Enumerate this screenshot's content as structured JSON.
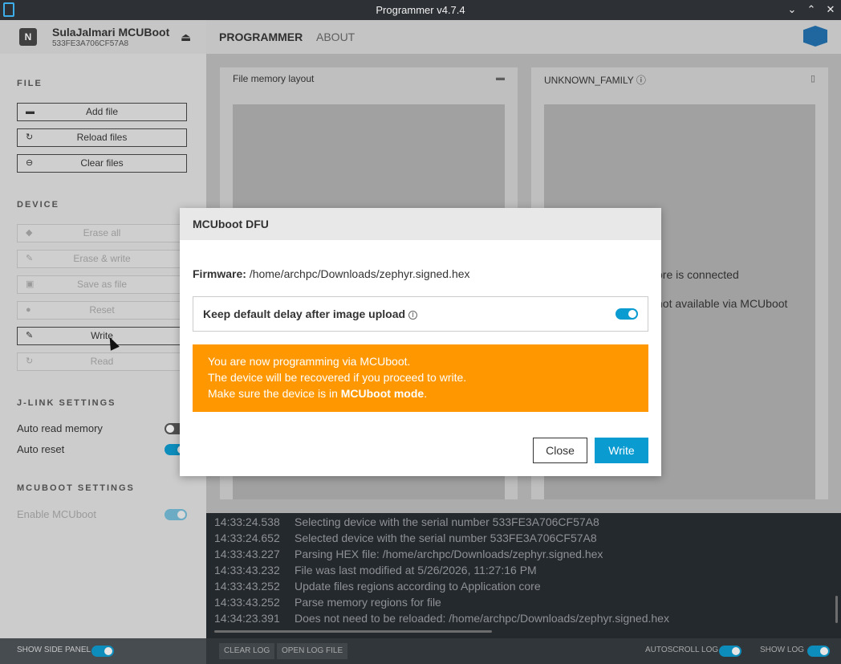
{
  "window": {
    "title": "Programmer v4.7.4",
    "controls": [
      "⌄",
      "⌃",
      "✕"
    ]
  },
  "header": {
    "device_name": "SulaJalmari MCUBoot",
    "device_serial": "533FE3A706CF57A8",
    "chip_letter": "N",
    "tabs": [
      "PROGRAMMER",
      "ABOUT"
    ]
  },
  "sidebar": {
    "file_title": "FILE",
    "file_buttons": [
      "Add file",
      "Reload files",
      "Clear files"
    ],
    "device_title": "DEVICE",
    "device_buttons": [
      "Erase all",
      "Erase & write",
      "Save as file",
      "Reset",
      "Write",
      "Read"
    ],
    "jlink_title": "J-LINK SETTINGS",
    "jlink_options": [
      "Auto read memory",
      "Auto reset"
    ],
    "mcuboot_title": "MCUBOOT SETTINGS",
    "mcuboot_option": "Enable MCUboot",
    "footer_label": "SHOW SIDE PANEL"
  },
  "main": {
    "file_card_title": "File memory layout",
    "device_card_title": "UNKNOWN_FAMILY",
    "device_card_text_1": "ore is connected",
    "device_card_text_2": "not available via MCUboot"
  },
  "log": {
    "entries": [
      {
        "ts": "14:33:24.538",
        "msg": "Selecting device with the serial number 533FE3A706CF57A8"
      },
      {
        "ts": "14:33:24.652",
        "msg": "Selected device with the serial number 533FE3A706CF57A8"
      },
      {
        "ts": "14:33:43.227",
        "msg": "Parsing HEX file: /home/archpc/Downloads/zephyr.signed.hex"
      },
      {
        "ts": "14:33:43.232",
        "msg": "File was last modified at 5/26/2026, 11:27:16 PM"
      },
      {
        "ts": "14:33:43.252",
        "msg": "Update files regions according to Application core"
      },
      {
        "ts": "14:33:43.252",
        "msg": "Parse memory regions for file"
      },
      {
        "ts": "14:34:23.391",
        "msg": "Does not need to be reloaded: /home/archpc/Downloads/zephyr.signed.hex"
      }
    ],
    "clear_label": "CLEAR LOG",
    "open_label": "OPEN LOG FILE",
    "autoscroll_label": "AUTOSCROLL LOG",
    "show_log_label": "SHOW LOG"
  },
  "modal": {
    "title": "MCUboot DFU",
    "firmware_label": "Firmware:",
    "firmware_path": "/home/archpc/Downloads/zephyr.signed.hex",
    "option_label": "Keep default delay after image upload",
    "option_on": true,
    "warning_line_1": "You are now programming via MCUboot.",
    "warning_line_2": "The device will be recovered if you proceed to write.",
    "warning_line_3_prefix": "Make sure the device is in ",
    "warning_line_3_bold": "MCUboot mode",
    "warning_line_3_suffix": ".",
    "close_label": "Close",
    "write_label": "Write"
  },
  "colors": {
    "accent": "#0a9bd1",
    "warning": "#ff9800"
  }
}
